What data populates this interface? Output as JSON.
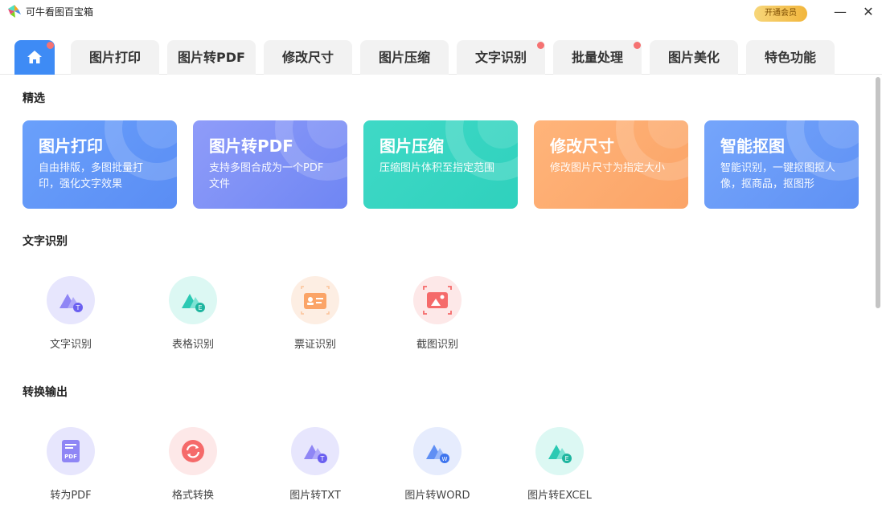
{
  "app": {
    "title": "可牛看图百宝箱",
    "vip_label": "开通会员",
    "minimize": "—",
    "close": "✕"
  },
  "tabs": [
    {
      "label": "",
      "icon": "home-icon",
      "dot": true
    },
    {
      "label": "图片打印",
      "dot": false
    },
    {
      "label": "图片转PDF",
      "dot": false
    },
    {
      "label": "修改尺寸",
      "dot": false
    },
    {
      "label": "图片压缩",
      "dot": false
    },
    {
      "label": "文字识别",
      "dot": true
    },
    {
      "label": "批量处理",
      "dot": true
    },
    {
      "label": "图片美化",
      "dot": false
    },
    {
      "label": "特色功能",
      "dot": false
    }
  ],
  "featured": {
    "title": "精选",
    "cards": [
      {
        "title": "图片打印",
        "desc": "自由排版，多图批量打印，强化文字效果",
        "color_from": "#6aa0fb",
        "color_to": "#5a8df4"
      },
      {
        "title": "图片转PDF",
        "desc": "支持多图合成为一个PDF文件",
        "color_from": "#8f9cf9",
        "color_to": "#6f86f3"
      },
      {
        "title": "图片压缩",
        "desc": "压缩图片体积至指定范围",
        "color_from": "#3fd9c6",
        "color_to": "#2fd1bd"
      },
      {
        "title": "修改尺寸",
        "desc": "修改图片尺寸为指定大小",
        "color_from": "#ffb47a",
        "color_to": "#fba467"
      },
      {
        "title": "智能抠图",
        "desc": "智能识别，一键抠图抠人像，抠商品，抠图形",
        "color_from": "#75a5fb",
        "color_to": "#5f91f4"
      }
    ]
  },
  "ocr": {
    "title": "文字识别",
    "items": [
      {
        "label": "文字识别",
        "icon": "text-recognition-icon",
        "bg": "#e7e6fd"
      },
      {
        "label": "表格识别",
        "icon": "table-recognition-icon",
        "bg": "#dcf8f3"
      },
      {
        "label": "票证识别",
        "icon": "id-card-recognition-icon",
        "bg": "#fdeee3"
      },
      {
        "label": "截图识别",
        "icon": "screenshot-recognition-icon",
        "bg": "#fde8e8"
      }
    ]
  },
  "convert": {
    "title": "转换输出",
    "items": [
      {
        "label": "转为PDF",
        "icon": "pdf-icon",
        "bg": "#e7e6fd"
      },
      {
        "label": "格式转换",
        "icon": "format-convert-icon",
        "bg": "#fde8e8"
      },
      {
        "label": "图片转TXT",
        "icon": "image-to-txt-icon",
        "bg": "#e7e6fd"
      },
      {
        "label": "图片转WORD",
        "icon": "image-to-word-icon",
        "bg": "#e6ecfd"
      },
      {
        "label": "图片转EXCEL",
        "icon": "image-to-excel-icon",
        "bg": "#dcf8f3"
      }
    ]
  }
}
